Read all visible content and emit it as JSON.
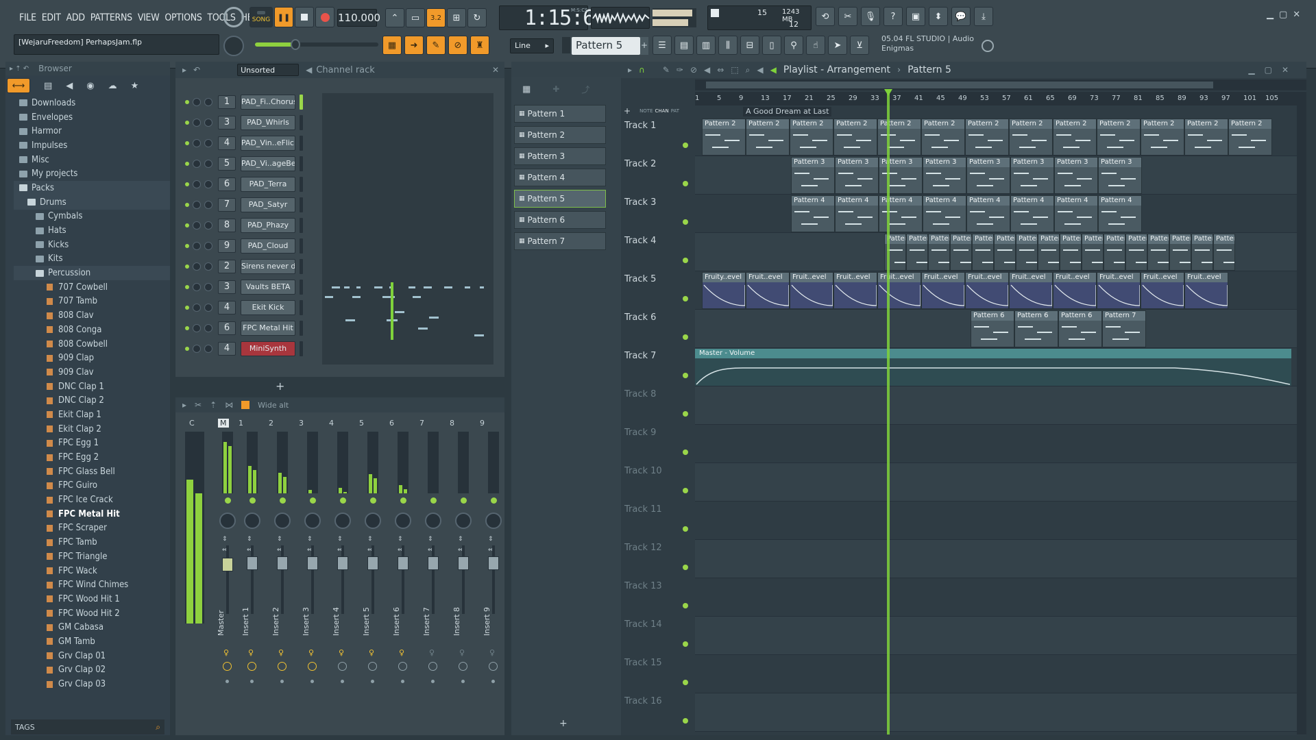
{
  "menu": [
    "FILE",
    "EDIT",
    "ADD",
    "PATTERNS",
    "VIEW",
    "OPTIONS",
    "TOOLS",
    "HELP"
  ],
  "transport": {
    "mode": "SONG",
    "tempo": "110.000",
    "time": "1:15:66",
    "time_unit": "M:S:CS",
    "cpu": "15",
    "memory": "1243 MB",
    "voices": "12"
  },
  "project": {
    "name": "[WejaruFreedom] PerhapsJam.flp",
    "snap_mode": "Line",
    "current_pattern": "Pattern 5",
    "news_version": "05.04",
    "news_text": "FL STUDIO | Audio Enigmas"
  },
  "browser": {
    "title": "Browser",
    "folders": [
      "Downloads",
      "Envelopes",
      "Harmor",
      "Impulses",
      "Misc",
      "My projects",
      "Packs",
      "Drums",
      "Cymbals",
      "Hats",
      "Kicks",
      "Kits",
      "Percussion"
    ],
    "files": [
      "707 Cowbell",
      "707 Tamb",
      "808 Clav",
      "808 Conga",
      "808 Cowbell",
      "909 Clap",
      "909 Clav",
      "DNC Clap 1",
      "DNC Clap 2",
      "Ekit Clap 1",
      "Ekit Clap 2",
      "FPC Egg 1",
      "FPC Egg 2",
      "FPC Glass Bell",
      "FPC Guiro",
      "FPC Ice Crack",
      "FPC Metal Hit",
      "FPC Scraper",
      "FPC Tamb",
      "FPC Triangle",
      "FPC Wack",
      "FPC Wind Chimes",
      "FPC Wood Hit 1",
      "FPC Wood Hit 2",
      "GM Cabasa",
      "GM Tamb",
      "Grv Clap 01",
      "Grv Clap 02",
      "Grv Clap 03"
    ],
    "selected": "FPC Metal Hit",
    "tags_label": "TAGS"
  },
  "channel_rack": {
    "title": "Channel rack",
    "filter": "Unsorted",
    "channels": [
      {
        "num": "1",
        "name": "PAD_Fi..Chorus"
      },
      {
        "num": "3",
        "name": "PAD_Whirls"
      },
      {
        "num": "4",
        "name": "PAD_Vin..eFlick"
      },
      {
        "num": "5",
        "name": "PAD_Vi..ageBell"
      },
      {
        "num": "6",
        "name": "PAD_Terra"
      },
      {
        "num": "7",
        "name": "PAD_Satyr"
      },
      {
        "num": "8",
        "name": "PAD_Phazy"
      },
      {
        "num": "9",
        "name": "PAD_Cloud"
      },
      {
        "num": "2",
        "name": "Sirens never die"
      },
      {
        "num": "3",
        "name": "Vaults BETA"
      },
      {
        "num": "4",
        "name": "Ekit Kick"
      },
      {
        "num": "6",
        "name": "FPC Metal Hit"
      },
      {
        "num": "4",
        "name": "MiniSynth"
      }
    ],
    "add_label": "+"
  },
  "mixer": {
    "preset": "Wide alt",
    "header": [
      "C",
      "M",
      "1",
      "2",
      "3",
      "4",
      "5",
      "6",
      "7",
      "8",
      "9"
    ],
    "strips": [
      "Master",
      "Insert 1",
      "Insert 2",
      "Insert 3",
      "Insert 4",
      "Insert 5",
      "Insert 6",
      "Insert 7",
      "Insert 8",
      "Insert 9"
    ]
  },
  "patterns": {
    "items": [
      "Pattern 1",
      "Pattern 2",
      "Pattern 3",
      "Pattern 4",
      "Pattern 5",
      "Pattern 6",
      "Pattern 7"
    ],
    "selected": "Pattern 5",
    "tabs": [
      "NOTE",
      "CHAN",
      "PAT"
    ]
  },
  "playlist": {
    "title": "Playlist - Arrangement",
    "breadcrumb": "Pattern 5",
    "marker": "A Good Dream at Last",
    "ruler": [
      "1",
      "5",
      "9",
      "13",
      "17",
      "21",
      "25",
      "29",
      "33",
      "37",
      "41",
      "45",
      "49",
      "53",
      "57",
      "61",
      "65",
      "69",
      "73",
      "77",
      "81",
      "85",
      "89",
      "93",
      "97",
      "101",
      "105"
    ],
    "tracks": [
      "Track 1",
      "Track 2",
      "Track 3",
      "Track 4",
      "Track 5",
      "Track 6",
      "Track 7",
      "Track 8",
      "Track 9",
      "Track 10",
      "Track 11",
      "Track 12",
      "Track 13",
      "Track 14",
      "Track 15",
      "Track 16"
    ],
    "clip_pattern2": "Pattern 2",
    "clip_pattern3": "Pattern 3",
    "clip_pattern4": "Pattern 4",
    "clip_fruity": "Fruity..evel",
    "clip_fruit": "Fruit..evel",
    "clip_pattern6": "Pattern 6",
    "clip_pattern7": "Pattern 7",
    "automation": "Master - Volume"
  }
}
